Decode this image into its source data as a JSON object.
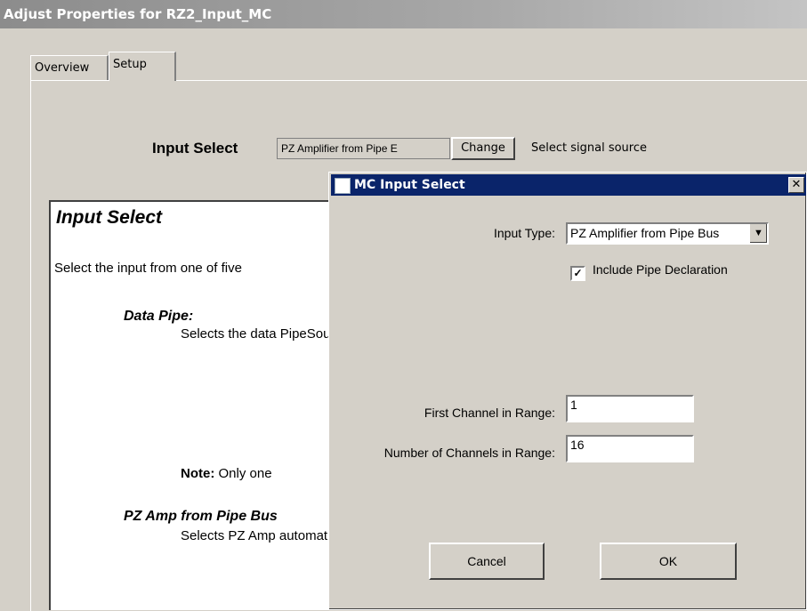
{
  "window": {
    "title": "Adjust Properties for RZ2_Input_MC"
  },
  "tabs": [
    {
      "label": "Overview"
    },
    {
      "label": "Setup"
    }
  ],
  "setup": {
    "input_select_label": "Input Select",
    "input_select_value": "PZ Amplifier from Pipe E",
    "change_button": "Change",
    "help_text": "Select signal source"
  },
  "help_panel": {
    "title": "Input Select",
    "intro": "Select the input from one of five",
    "data_pipe_heading": "Data Pipe:",
    "data_pipe_text": "Selects the data\nPipeSource com\nbox is checked,\none of the availa\na PipeSource cc",
    "note_label": "Note:",
    "note_text": " Only one",
    "pz_amp_heading": "PZ Amp from Pipe Bus",
    "pz_amp_text": "Selects PZ Amp\nautomatically inc\nthe input data."
  },
  "dialog": {
    "title": "MC Input Select",
    "close_glyph": "✕",
    "input_type_label": "Input Type:",
    "input_type_value": "PZ Amplifier from Pipe Bus",
    "include_pipe_label": "Include Pipe Declaration",
    "include_pipe_checked": true,
    "checkbox_glyph": "✓",
    "dropdown_glyph": "▼",
    "first_channel_label": "First Channel in Range:",
    "first_channel_value": "1",
    "num_channels_label": "Number of Channels in Range:",
    "num_channels_value": "16",
    "cancel_button": "Cancel",
    "ok_button": "OK"
  }
}
